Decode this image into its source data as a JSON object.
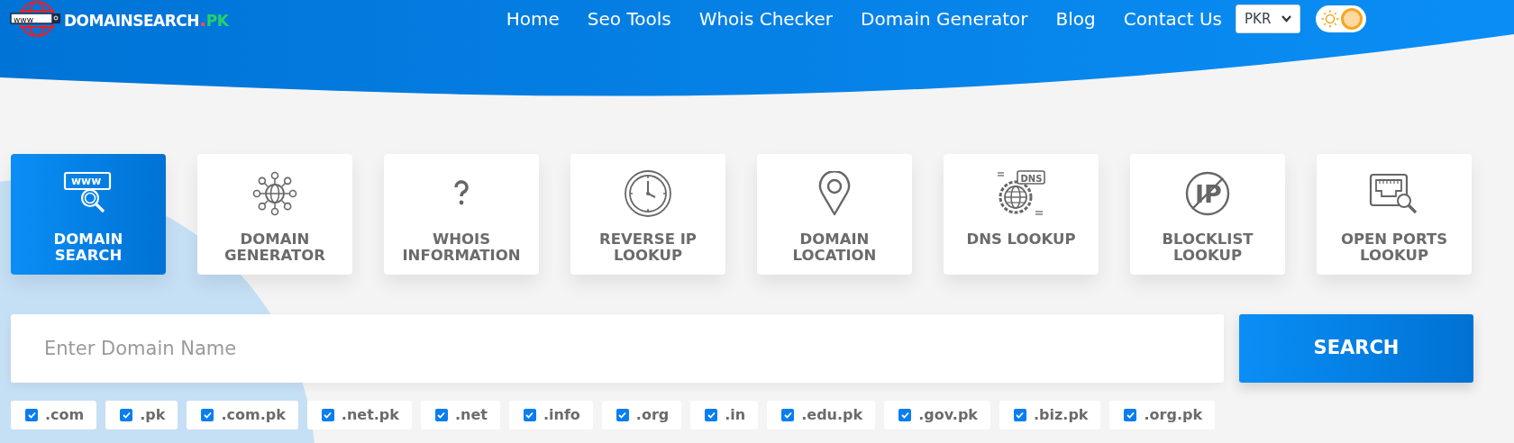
{
  "logo": {
    "badge": "www",
    "name": "DOMAINSEARCH",
    "dot": ".",
    "tld": "PK"
  },
  "nav": [
    {
      "label": "Home"
    },
    {
      "label": "Seo Tools"
    },
    {
      "label": "Whois Checker"
    },
    {
      "label": "Domain Generator"
    },
    {
      "label": "Blog"
    },
    {
      "label": "Contact Us"
    }
  ],
  "currency": {
    "value": "PKR"
  },
  "theme_toggle": {
    "on": true
  },
  "tools": [
    {
      "label": "DOMAIN SEARCH",
      "kind": "www-search",
      "icon_text": "www",
      "selected": true
    },
    {
      "label": "DOMAIN GENERATOR",
      "kind": "network",
      "selected": false
    },
    {
      "label": "WHOIS INFORMATION",
      "kind": "question",
      "selected": false
    },
    {
      "label": "REVERSE IP LOOKUP",
      "kind": "clock",
      "selected": false
    },
    {
      "label": "DOMAIN LOCATION",
      "kind": "pin",
      "selected": false
    },
    {
      "label": "DNS LOOKUP",
      "kind": "dns",
      "icon_text": "DNS",
      "selected": false
    },
    {
      "label": "BLOCKLIST LOOKUP",
      "kind": "ip-blocked",
      "icon_text": "IP",
      "selected": false
    },
    {
      "label": "OPEN PORTS LOOKUP",
      "kind": "port",
      "selected": false
    }
  ],
  "search": {
    "placeholder": "Enter Domain Name",
    "button": "SEARCH"
  },
  "extensions": [
    {
      "label": ".com",
      "checked": true
    },
    {
      "label": ".pk",
      "checked": true
    },
    {
      "label": ".com.pk",
      "checked": true
    },
    {
      "label": ".net.pk",
      "checked": true
    },
    {
      "label": ".net",
      "checked": true
    },
    {
      "label": ".info",
      "checked": true
    },
    {
      "label": ".org",
      "checked": true
    },
    {
      "label": ".in",
      "checked": true
    },
    {
      "label": ".edu.pk",
      "checked": true
    },
    {
      "label": ".gov.pk",
      "checked": true
    },
    {
      "label": ".biz.pk",
      "checked": true
    },
    {
      "label": ".org.pk",
      "checked": true
    }
  ]
}
